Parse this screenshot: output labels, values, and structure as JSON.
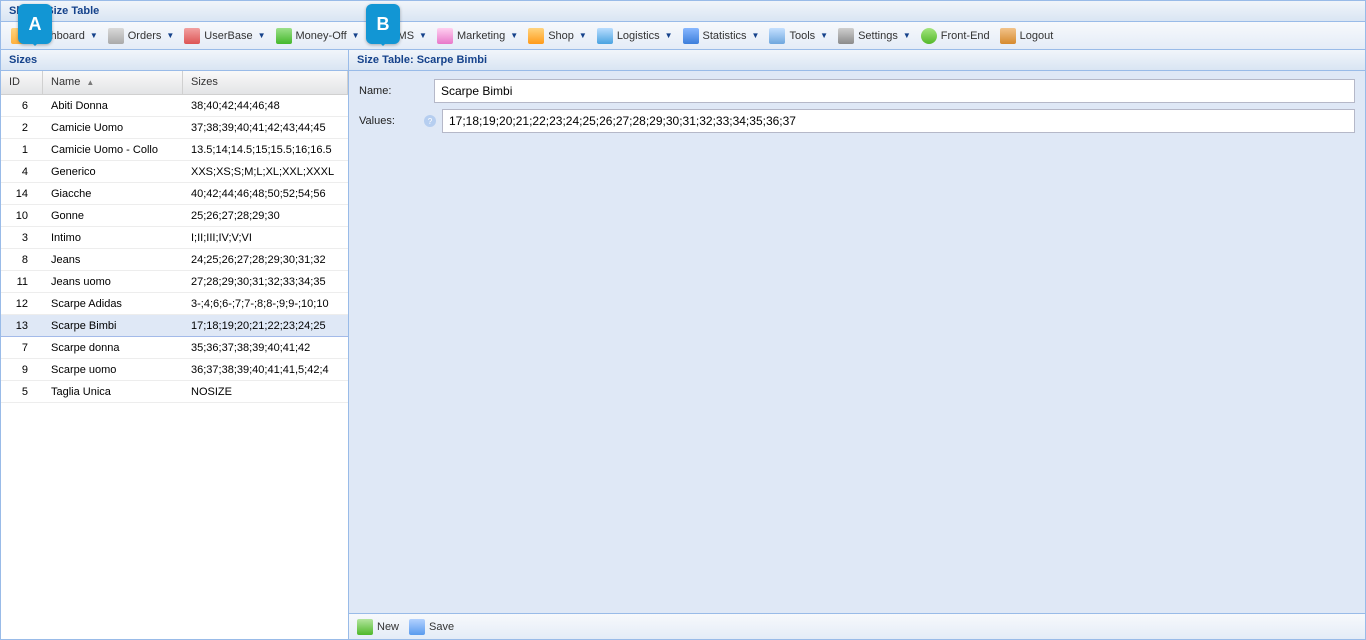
{
  "window": {
    "title": "Shop - Size Table"
  },
  "toolbar": [
    {
      "name": "dashboard-button",
      "label": "Dashboard",
      "icon": "ic-dash",
      "dropdown": true
    },
    {
      "name": "orders-button",
      "label": "Orders",
      "icon": "ic-orders",
      "dropdown": true
    },
    {
      "name": "userbase-button",
      "label": "UserBase",
      "icon": "ic-user",
      "dropdown": true
    },
    {
      "name": "moneyoff-button",
      "label": "Money-Off",
      "icon": "ic-money",
      "dropdown": true
    },
    {
      "name": "cms-button",
      "label": "CMS",
      "icon": "ic-cms",
      "dropdown": true
    },
    {
      "name": "marketing-button",
      "label": "Marketing",
      "icon": "ic-mkt",
      "dropdown": true
    },
    {
      "name": "shop-button",
      "label": "Shop",
      "icon": "ic-shop",
      "dropdown": true
    },
    {
      "name": "logistics-button",
      "label": "Logistics",
      "icon": "ic-log",
      "dropdown": true
    },
    {
      "name": "statistics-button",
      "label": "Statistics",
      "icon": "ic-stat",
      "dropdown": true
    },
    {
      "name": "tools-button",
      "label": "Tools",
      "icon": "ic-tools",
      "dropdown": true
    },
    {
      "name": "settings-button",
      "label": "Settings",
      "icon": "ic-set",
      "dropdown": true
    },
    {
      "name": "frontend-button",
      "label": "Front-End",
      "icon": "ic-fe",
      "dropdown": false
    },
    {
      "name": "logout-button",
      "label": "Logout",
      "icon": "ic-out",
      "dropdown": false
    }
  ],
  "left": {
    "title": "Sizes",
    "columns": {
      "id": "ID",
      "name": "Name",
      "sizes": "Sizes"
    },
    "rows": [
      {
        "id": "6",
        "name": "Abiti Donna",
        "sizes": "38;40;42;44;46;48",
        "selected": false
      },
      {
        "id": "2",
        "name": "Camicie Uomo",
        "sizes": "37;38;39;40;41;42;43;44;45",
        "selected": false
      },
      {
        "id": "1",
        "name": "Camicie Uomo - Collo",
        "sizes": "13.5;14;14.5;15;15.5;16;16.5",
        "selected": false
      },
      {
        "id": "4",
        "name": "Generico",
        "sizes": "XXS;XS;S;M;L;XL;XXL;XXXL",
        "selected": false
      },
      {
        "id": "14",
        "name": "Giacche",
        "sizes": "40;42;44;46;48;50;52;54;56",
        "selected": false
      },
      {
        "id": "10",
        "name": "Gonne",
        "sizes": "25;26;27;28;29;30",
        "selected": false
      },
      {
        "id": "3",
        "name": "Intimo",
        "sizes": "I;II;III;IV;V;VI",
        "selected": false
      },
      {
        "id": "8",
        "name": "Jeans",
        "sizes": "24;25;26;27;28;29;30;31;32",
        "selected": false
      },
      {
        "id": "11",
        "name": "Jeans uomo",
        "sizes": "27;28;29;30;31;32;33;34;35",
        "selected": false
      },
      {
        "id": "12",
        "name": "Scarpe Adidas",
        "sizes": "3-;4;6;6-;7;7-;8;8-;9;9-;10;10",
        "selected": false
      },
      {
        "id": "13",
        "name": "Scarpe Bimbi",
        "sizes": "17;18;19;20;21;22;23;24;25",
        "selected": true
      },
      {
        "id": "7",
        "name": "Scarpe donna",
        "sizes": "35;36;37;38;39;40;41;42",
        "selected": false
      },
      {
        "id": "9",
        "name": "Scarpe uomo",
        "sizes": "36;37;38;39;40;41;41,5;42;4",
        "selected": false
      },
      {
        "id": "5",
        "name": "Taglia Unica",
        "sizes": "NOSIZE",
        "selected": false
      }
    ]
  },
  "right": {
    "title": "Size Table: Scarpe Bimbi",
    "name_label": "Name:",
    "name_value": "Scarpe Bimbi",
    "values_label": "Values:",
    "values_value": "17;18;19;20;21;22;23;24;25;26;27;28;29;30;31;32;33;34;35;36;37",
    "buttons": {
      "new": "New",
      "save": "Save"
    }
  },
  "bubbles": {
    "a": "A",
    "b": "B"
  }
}
